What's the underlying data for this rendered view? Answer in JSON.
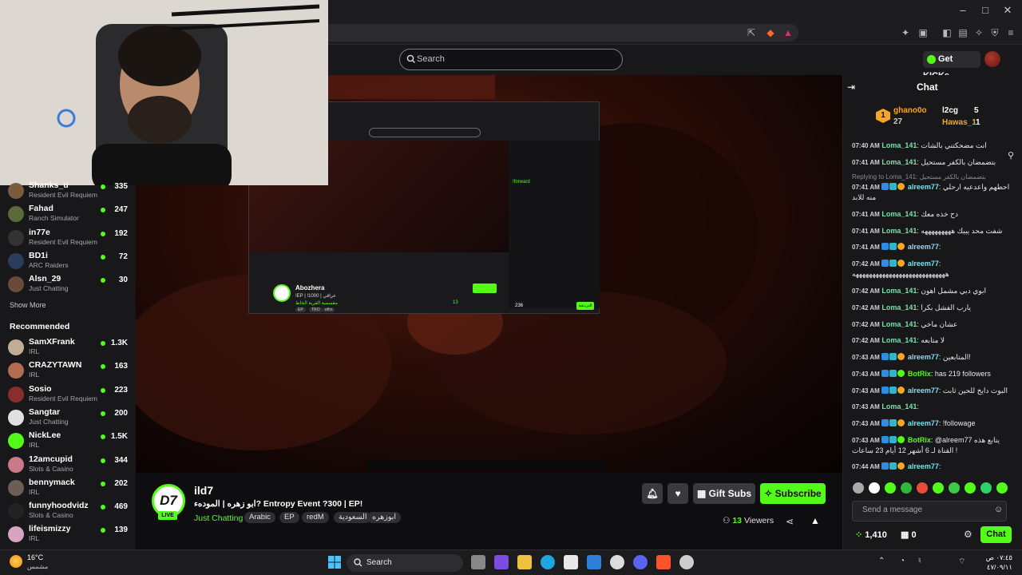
{
  "browser": {
    "window_title": "",
    "controls": [
      "–",
      "□",
      "✕"
    ]
  },
  "header": {
    "search_placeholder": "Search",
    "get_kicks": "Get KICKs"
  },
  "sidebar": {
    "channels": [
      {
        "name": "Shanks_u",
        "category": "Resident Evil Requiem",
        "viewers": "335",
        "color": "#7a5b3b"
      },
      {
        "name": "Fahad",
        "category": "Ranch Simulator",
        "viewers": "247",
        "color": "#5a6a3a"
      },
      {
        "name": "in77e",
        "category": "Resident Evil Requiem",
        "viewers": "192",
        "color": "#333"
      },
      {
        "name": "BD1i",
        "category": "ARC Raiders",
        "viewers": "72",
        "color": "#2a3d5a"
      },
      {
        "name": "Alsn_29",
        "category": "Just Chatting",
        "viewers": "30",
        "color": "#6a4a3a"
      }
    ],
    "show_more": "Show More",
    "recommended_title": "Recommended",
    "recommended": [
      {
        "name": "SamXFrank",
        "category": "IRL",
        "viewers": "1.3K",
        "color": "#bfae93"
      },
      {
        "name": "CRAZYTAWN",
        "category": "IRL",
        "viewers": "163",
        "color": "#b36b52"
      },
      {
        "name": "Sosio",
        "category": "Resident Evil Requiem",
        "viewers": "223",
        "color": "#8a2d2d"
      },
      {
        "name": "Sangtar",
        "category": "Just Chatting",
        "viewers": "200",
        "color": "#e0e0e0"
      },
      {
        "name": "NickLee",
        "category": "IRL",
        "viewers": "1.5K",
        "color": "#53fc18"
      },
      {
        "name": "12amcupid",
        "category": "Slots & Casino",
        "viewers": "344",
        "color": "#c87a8a"
      },
      {
        "name": "bennymack",
        "category": "IRL",
        "viewers": "202",
        "color": "#6c5d55"
      },
      {
        "name": "funnyhoodvidz",
        "category": "Slots & Casino",
        "viewers": "469",
        "color": "#222"
      },
      {
        "name": "lifeismizzy",
        "category": "IRL",
        "viewers": "139",
        "color": "#d9a4c0"
      }
    ]
  },
  "nested": {
    "streamer": "Abozhera",
    "title": "!EP | !1000 | عراقي",
    "category": "مقسمية القرية الخاط",
    "tags": [
      "EP",
      "TRO",
      "ethx"
    ],
    "chat_label": "الدردشة",
    "viewers": "13",
    "points": "236"
  },
  "stream": {
    "streamer": "ild7",
    "avatar_text": "D7",
    "live": "LIVE",
    "title": "ابو زهره | المودهء? Entropy Event ?300 | EP!",
    "category": "Just Chatting",
    "tags": [
      "Arabic",
      "EP",
      "redM",
      "السعودية",
      "ابوزهره"
    ],
    "gift_subs": "Gift Subs",
    "subscribe": "Subscribe",
    "viewers": "13",
    "viewers_label": "Viewers"
  },
  "chat": {
    "title": "Chat",
    "leaderboard": [
      {
        "name": "ghano0o",
        "value": "27",
        "color": "#fff"
      },
      {
        "name": "l2cg",
        "value": "5",
        "color": "#fff"
      },
      {
        "name": "Hawas_1",
        "value": "1",
        "color": "#f5a623"
      }
    ],
    "messages": [
      {
        "time": "07:40 AM",
        "user": "Loma_141",
        "color": "#7ee0a8",
        "text": "انت مضحكتني بالشات"
      },
      {
        "time": "07:41 AM",
        "user": "Loma_141",
        "color": "#7ee0a8",
        "text": "بتضمضان بالكفر مستحيل"
      },
      {
        "reply": "Replying to Loma_141: بتضمضان بالكفر مستحيل"
      },
      {
        "time": "07:41 AM",
        "user": "alreem77",
        "color": "#7ee0f0",
        "text": "احطهم واعدعيه ارحلي منه للابد"
      },
      {
        "time": "07:41 AM",
        "user": "Loma_141",
        "color": "#7ee0a8",
        "text": "دح خذه معك"
      },
      {
        "time": "07:41 AM",
        "user": "Loma_141",
        "color": "#7ee0a8",
        "text": "شفت محد يبيك هههههههههه"
      },
      {
        "time": "07:41 AM",
        "user": "alreem77",
        "color": "#7ee0f0",
        "text": ""
      },
      {
        "time": "07:42 AM",
        "user": "alreem77",
        "color": "#7ee0f0",
        "text": "ههههههههههههههههههههههههههههه"
      },
      {
        "time": "07:42 AM",
        "user": "Loma_141",
        "color": "#7ee0a8",
        "text": "ابوي دبي مشمل اهون"
      },
      {
        "time": "07:42 AM",
        "user": "Loma_141",
        "color": "#7ee0a8",
        "text": "يارب الفشل بكرا"
      },
      {
        "time": "07:42 AM",
        "user": "Loma_141",
        "color": "#7ee0a8",
        "text": "عشان ماخي"
      },
      {
        "time": "07:42 AM",
        "user": "Loma_141",
        "color": "#7ee0a8",
        "text": "لا متابعه"
      },
      {
        "time": "07:43 AM",
        "user": "alreem77",
        "color": "#7ee0f0",
        "text": "المتابعين!"
      },
      {
        "time": "07:43 AM",
        "user": "BotRix",
        "color": "#53fc18",
        "text": "has 219 followers"
      },
      {
        "time": "07:43 AM",
        "user": "alreem77",
        "color": "#7ee0f0",
        "text": "البوت دايخ للحين ثابت"
      },
      {
        "time": "07:43 AM",
        "user": "Loma_141",
        "color": "#7ee0a8",
        "text": ""
      },
      {
        "time": "07:43 AM",
        "user": "alreem77",
        "color": "#7ee0f0",
        "text": "!followage"
      },
      {
        "time": "07:43 AM",
        "user": "BotRix",
        "color": "#53fc18",
        "text": "@alreem77 يتابع هذه القناة لـ 6 أشهر 12 أيام 23 ساعات !"
      },
      {
        "time": "07:44 AM",
        "user": "alreem77",
        "color": "#7ee0f0",
        "text": ""
      }
    ],
    "input_placeholder": "Send a message",
    "points": "1,410",
    "points_b": "0",
    "send": "Chat"
  },
  "taskbar": {
    "temp": "16°C",
    "weather": "مشمس",
    "search": "Search",
    "time": "٠٧:٤٥ ص",
    "date": "٤٧/٠٩/١١"
  }
}
